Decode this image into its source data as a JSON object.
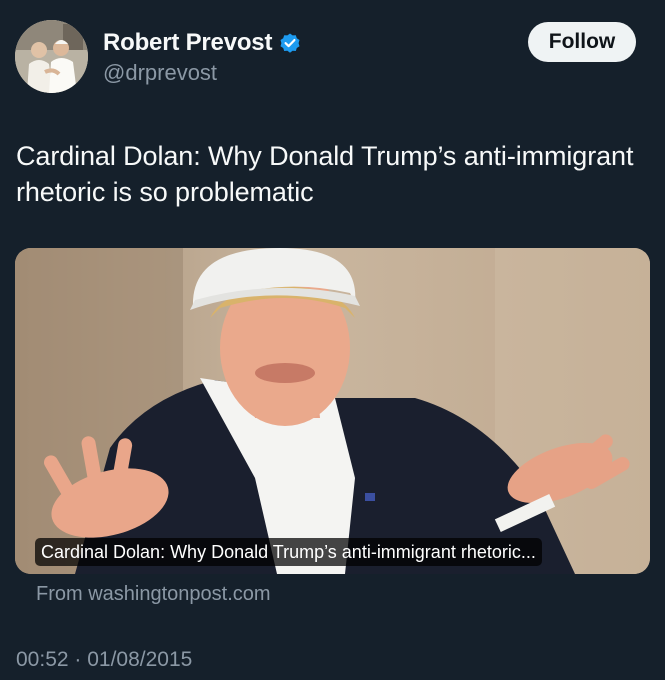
{
  "author": {
    "name": "Robert Prevost",
    "handle": "@drprevost",
    "verified": true,
    "verified_color": "#1d9bf0"
  },
  "follow_button": {
    "label": "Follow"
  },
  "tweet": {
    "text": "Cardinal Dolan: Why Donald Trump’s anti-immigrant rhetoric is so problematic"
  },
  "link_card": {
    "caption": "Cardinal Dolan: Why Donald Trump’s anti-immigrant rhetoric...",
    "source": "From washingtonpost.com"
  },
  "meta": {
    "timestamp": "00:52 · 01/08/2015"
  },
  "colors": {
    "background": "#15202b",
    "primary_text": "#f7f9f9",
    "secondary_text": "#8b98a5",
    "follow_bg": "#eff3f4"
  }
}
